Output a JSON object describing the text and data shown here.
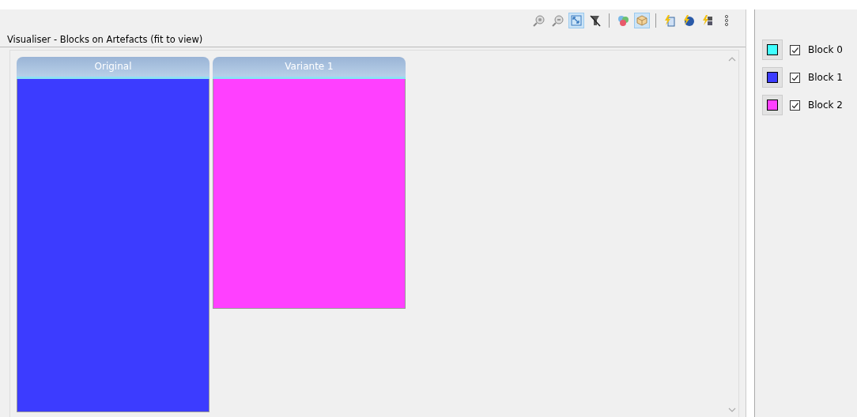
{
  "toolbar": [
    {
      "kind": "zoom-in",
      "selected": false
    },
    {
      "kind": "zoom-out",
      "selected": false
    },
    {
      "kind": "fit",
      "selected": true
    },
    {
      "kind": "filter",
      "selected": false
    },
    {
      "kind": "separator"
    },
    {
      "kind": "colors",
      "selected": false
    },
    {
      "kind": "cube",
      "selected": true
    },
    {
      "kind": "separator"
    },
    {
      "kind": "bolt-doc",
      "selected": false
    },
    {
      "kind": "bolt-globe",
      "selected": false
    },
    {
      "kind": "bolt-grid",
      "selected": false
    },
    {
      "kind": "more"
    }
  ],
  "view": {
    "title": "Visualiser - Blocks on Artefacts (fit to view)",
    "artefacts": [
      {
        "title": "Original",
        "color": "#3c3cff"
      },
      {
        "title": "Variante 1",
        "color": "#ff40ff"
      }
    ]
  },
  "legend": [
    {
      "label": "Block 0",
      "color": "#40ffff",
      "checked": true
    },
    {
      "label": "Block 1",
      "color": "#3c3cff",
      "checked": true
    },
    {
      "label": "Block 2",
      "color": "#ff40ff",
      "checked": true
    }
  ]
}
